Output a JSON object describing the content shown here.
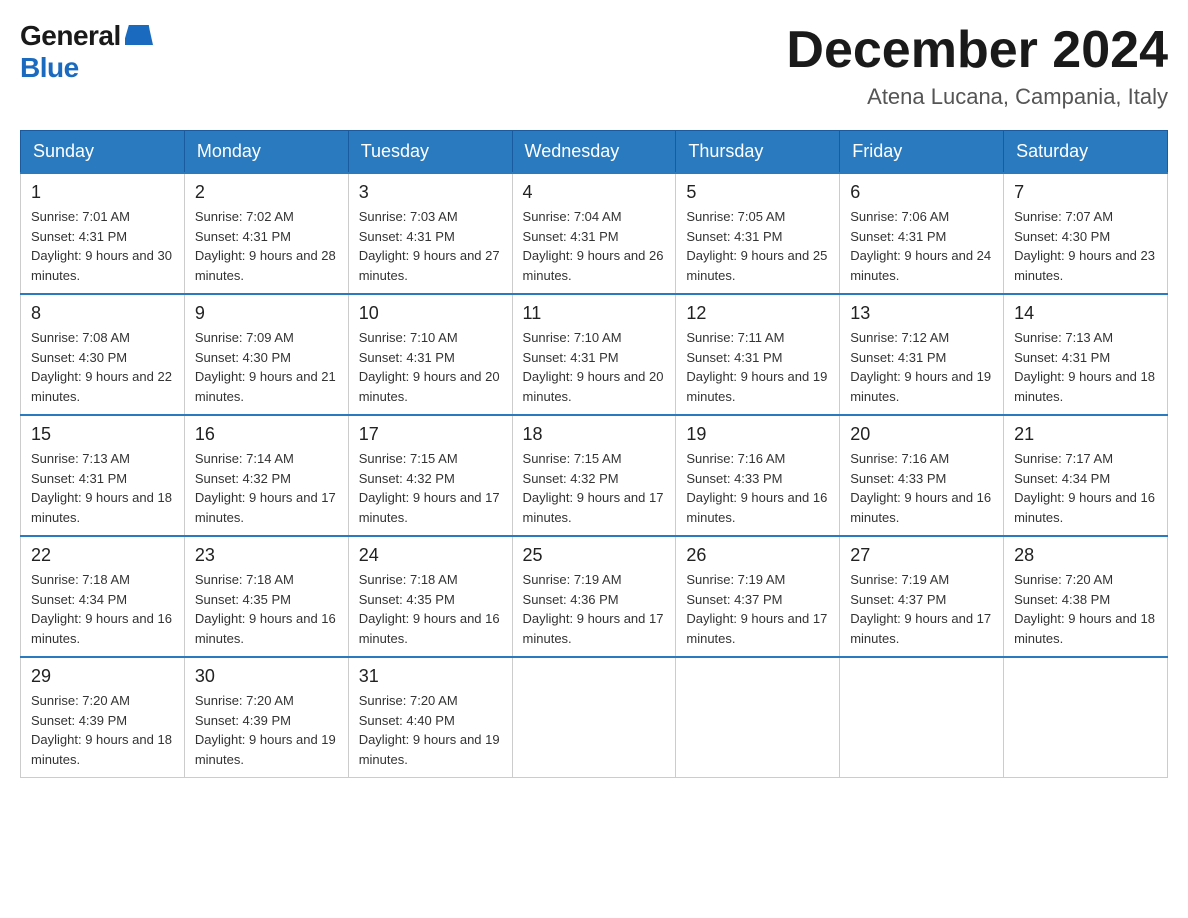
{
  "header": {
    "logo_general": "General",
    "logo_blue": "Blue",
    "month_title": "December 2024",
    "location": "Atena Lucana, Campania, Italy"
  },
  "days_of_week": [
    "Sunday",
    "Monday",
    "Tuesday",
    "Wednesday",
    "Thursday",
    "Friday",
    "Saturday"
  ],
  "weeks": [
    [
      {
        "day": "1",
        "sunrise": "7:01 AM",
        "sunset": "4:31 PM",
        "daylight": "9 hours and 30 minutes."
      },
      {
        "day": "2",
        "sunrise": "7:02 AM",
        "sunset": "4:31 PM",
        "daylight": "9 hours and 28 minutes."
      },
      {
        "day": "3",
        "sunrise": "7:03 AM",
        "sunset": "4:31 PM",
        "daylight": "9 hours and 27 minutes."
      },
      {
        "day": "4",
        "sunrise": "7:04 AM",
        "sunset": "4:31 PM",
        "daylight": "9 hours and 26 minutes."
      },
      {
        "day": "5",
        "sunrise": "7:05 AM",
        "sunset": "4:31 PM",
        "daylight": "9 hours and 25 minutes."
      },
      {
        "day": "6",
        "sunrise": "7:06 AM",
        "sunset": "4:31 PM",
        "daylight": "9 hours and 24 minutes."
      },
      {
        "day": "7",
        "sunrise": "7:07 AM",
        "sunset": "4:30 PM",
        "daylight": "9 hours and 23 minutes."
      }
    ],
    [
      {
        "day": "8",
        "sunrise": "7:08 AM",
        "sunset": "4:30 PM",
        "daylight": "9 hours and 22 minutes."
      },
      {
        "day": "9",
        "sunrise": "7:09 AM",
        "sunset": "4:30 PM",
        "daylight": "9 hours and 21 minutes."
      },
      {
        "day": "10",
        "sunrise": "7:10 AM",
        "sunset": "4:31 PM",
        "daylight": "9 hours and 20 minutes."
      },
      {
        "day": "11",
        "sunrise": "7:10 AM",
        "sunset": "4:31 PM",
        "daylight": "9 hours and 20 minutes."
      },
      {
        "day": "12",
        "sunrise": "7:11 AM",
        "sunset": "4:31 PM",
        "daylight": "9 hours and 19 minutes."
      },
      {
        "day": "13",
        "sunrise": "7:12 AM",
        "sunset": "4:31 PM",
        "daylight": "9 hours and 19 minutes."
      },
      {
        "day": "14",
        "sunrise": "7:13 AM",
        "sunset": "4:31 PM",
        "daylight": "9 hours and 18 minutes."
      }
    ],
    [
      {
        "day": "15",
        "sunrise": "7:13 AM",
        "sunset": "4:31 PM",
        "daylight": "9 hours and 18 minutes."
      },
      {
        "day": "16",
        "sunrise": "7:14 AM",
        "sunset": "4:32 PM",
        "daylight": "9 hours and 17 minutes."
      },
      {
        "day": "17",
        "sunrise": "7:15 AM",
        "sunset": "4:32 PM",
        "daylight": "9 hours and 17 minutes."
      },
      {
        "day": "18",
        "sunrise": "7:15 AM",
        "sunset": "4:32 PM",
        "daylight": "9 hours and 17 minutes."
      },
      {
        "day": "19",
        "sunrise": "7:16 AM",
        "sunset": "4:33 PM",
        "daylight": "9 hours and 16 minutes."
      },
      {
        "day": "20",
        "sunrise": "7:16 AM",
        "sunset": "4:33 PM",
        "daylight": "9 hours and 16 minutes."
      },
      {
        "day": "21",
        "sunrise": "7:17 AM",
        "sunset": "4:34 PM",
        "daylight": "9 hours and 16 minutes."
      }
    ],
    [
      {
        "day": "22",
        "sunrise": "7:18 AM",
        "sunset": "4:34 PM",
        "daylight": "9 hours and 16 minutes."
      },
      {
        "day": "23",
        "sunrise": "7:18 AM",
        "sunset": "4:35 PM",
        "daylight": "9 hours and 16 minutes."
      },
      {
        "day": "24",
        "sunrise": "7:18 AM",
        "sunset": "4:35 PM",
        "daylight": "9 hours and 16 minutes."
      },
      {
        "day": "25",
        "sunrise": "7:19 AM",
        "sunset": "4:36 PM",
        "daylight": "9 hours and 17 minutes."
      },
      {
        "day": "26",
        "sunrise": "7:19 AM",
        "sunset": "4:37 PM",
        "daylight": "9 hours and 17 minutes."
      },
      {
        "day": "27",
        "sunrise": "7:19 AM",
        "sunset": "4:37 PM",
        "daylight": "9 hours and 17 minutes."
      },
      {
        "day": "28",
        "sunrise": "7:20 AM",
        "sunset": "4:38 PM",
        "daylight": "9 hours and 18 minutes."
      }
    ],
    [
      {
        "day": "29",
        "sunrise": "7:20 AM",
        "sunset": "4:39 PM",
        "daylight": "9 hours and 18 minutes."
      },
      {
        "day": "30",
        "sunrise": "7:20 AM",
        "sunset": "4:39 PM",
        "daylight": "9 hours and 19 minutes."
      },
      {
        "day": "31",
        "sunrise": "7:20 AM",
        "sunset": "4:40 PM",
        "daylight": "9 hours and 19 minutes."
      },
      null,
      null,
      null,
      null
    ]
  ],
  "labels": {
    "sunrise_prefix": "Sunrise: ",
    "sunset_prefix": "Sunset: ",
    "daylight_prefix": "Daylight: "
  }
}
